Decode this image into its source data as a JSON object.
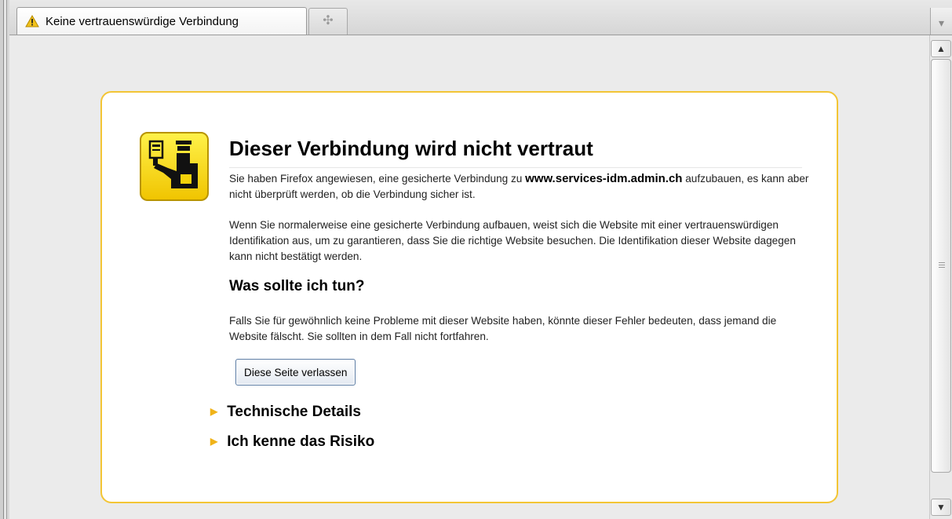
{
  "tabs": [
    {
      "title": "Keine vertrauenswürdige Verbindung",
      "icon": "warning-icon"
    }
  ],
  "new_tab_icon": "plus-icon",
  "tab_list_icon": "dropdown-arrow-icon",
  "error_page": {
    "title": "Dieser Verbindung wird nicht vertraut",
    "intro_before": "Sie haben Firefox angewiesen, eine gesicherte Verbindung zu ",
    "host": "www.services-idm.admin.ch",
    "intro_after": " aufzubauen, es kann aber nicht überprüft werden, ob die Verbindung sicher ist.",
    "explanation": "Wenn Sie normalerweise eine gesicherte Verbindung aufbauen, weist sich die Website mit einer vertrauenswürdigen Identifikation aus, um zu garantieren, dass Sie die richtige Website besuchen. Die Identifikation dieser Website dagegen kann nicht bestätigt werden.",
    "what_to_do_heading": "Was sollte ich tun?",
    "what_to_do_text": "Falls Sie für gewöhnlich keine Probleme mit dieser Website haben, könnte dieser Fehler bedeuten, dass jemand die Website fälscht. Sie sollten in dem Fall nicht fortfahren.",
    "leave_button": "Diese Seite verlassen",
    "technical_details": "Technische Details",
    "understand_risks": "Ich kenne das Risiko"
  },
  "colors": {
    "accent_yellow": "#f3c535",
    "arrow_color": "#f0b319",
    "page_background": "#ebebeb"
  }
}
